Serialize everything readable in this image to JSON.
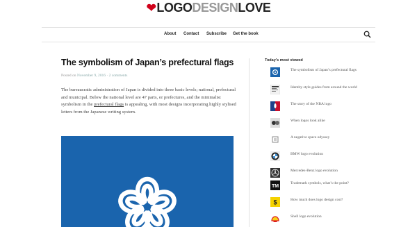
{
  "logo": {
    "heart": "❤",
    "part1": "LOGO",
    "part2": "DESIGN",
    "part3": "LOVE"
  },
  "nav": {
    "items": [
      "About",
      "Contact",
      "Subscribe",
      "Get the book"
    ]
  },
  "article": {
    "title": "The symbolism of Japan’s prefectural flags",
    "meta_prefix": "Posted on",
    "date": "November 9, 2016",
    "comments": "2 comments",
    "paragraph_before_link": "The bureaucratic administration of Japan is divided into three basic levels; national, prefectural and municipal. Below the national level are 47 parts, or prefectures, and the minimalist symbolism in the ",
    "link_text": "prefectural flags",
    "paragraph_after_link": " is appealing, with most designs incorporating highly stylised letters from the Japanese writing system."
  },
  "sidebar": {
    "heading": "Today’s most viewed",
    "items": [
      {
        "label": "The symbolism of Japan’s prefectural flags",
        "icon": "japan-flag-thumb"
      },
      {
        "label": "Identity style guides from around the world",
        "icon": "style-guide-thumb"
      },
      {
        "label": "The story of the NBA logo",
        "icon": "nba-thumb"
      },
      {
        "label": "When logos look alike",
        "icon": "logos-alike-thumb"
      },
      {
        "label": "A negative space odyssey",
        "icon": "negative-space-thumb"
      },
      {
        "label": "BMW logo evolution",
        "icon": "bmw-thumb"
      },
      {
        "label": "Mercedes-Benz logo evolution",
        "icon": "mercedes-thumb"
      },
      {
        "label": "Trademark symbols, what’s the point?",
        "icon": "trademark-thumb"
      },
      {
        "label": "How much does logo design cost?",
        "icon": "logo-cost-thumb"
      },
      {
        "label": "Shell logo evolution",
        "icon": "shell-thumb"
      }
    ]
  },
  "colors": {
    "accent_red": "#d0021b",
    "flag_blue": "#1a64ad",
    "nba_red": "#c8102e",
    "nba_blue": "#1d428a"
  }
}
